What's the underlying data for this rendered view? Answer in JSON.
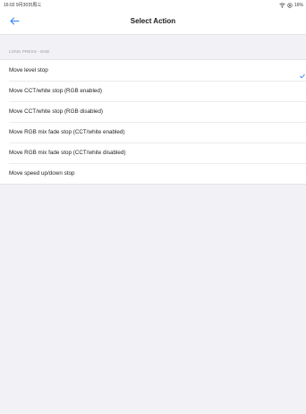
{
  "status_bar": {
    "time": "16:02  9月30日周三",
    "battery": "16%",
    "wifi_icon": "wifi-icon",
    "orientation_icon": "orientation-lock-icon"
  },
  "nav": {
    "back_icon": "arrow-left-icon",
    "title": "Select Action"
  },
  "section": {
    "header": "LONG PRESS - END"
  },
  "colors": {
    "accent": "#2f7df6",
    "background": "#f2f2f6"
  },
  "items": [
    {
      "label": "Move level stop",
      "selected": true
    },
    {
      "label": "Move CCT/white stop (RGB enabled)",
      "selected": false
    },
    {
      "label": "Move CCT/white stop (RGB disabled)",
      "selected": false
    },
    {
      "label": "Move RGB mix fade stop (CCT/white enabled)",
      "selected": false
    },
    {
      "label": "Move RGB mix fade stop (CCT/white disabled)",
      "selected": false
    },
    {
      "label": "Move speed up/down stop",
      "selected": false
    }
  ]
}
